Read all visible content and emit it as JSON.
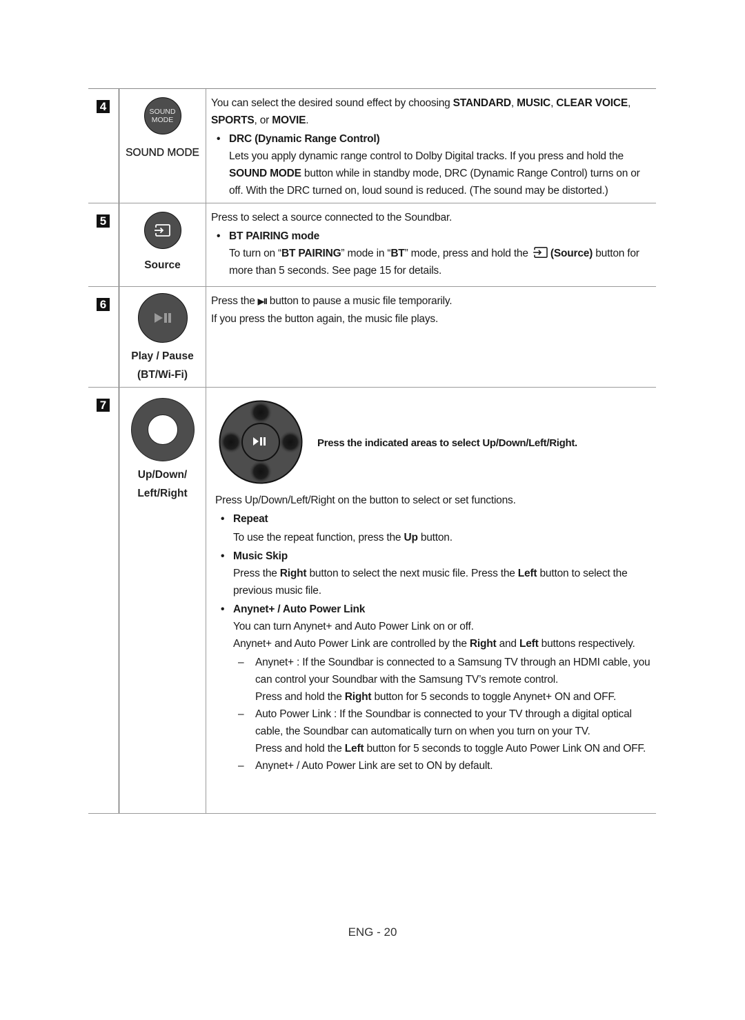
{
  "rows": [
    {
      "number": "4",
      "icon": "sound-mode-button-icon",
      "icon_text": [
        "SOUND",
        "MODE"
      ],
      "label": "SOUND MODE",
      "intro": {
        "t1": "You can select the desired sound effect by choosing ",
        "b1": "STANDARD",
        "t2": ", ",
        "b2": "MUSIC",
        "t3": ", ",
        "b3": "CLEAR VOICE",
        "t4": ", ",
        "b4": "SPORTS",
        "t5": ", or ",
        "b5": "MOVIE",
        "t6": "."
      },
      "bullet": {
        "title": "DRC (Dynamic Range Control)",
        "t1": "Lets you apply dynamic range control to Dolby Digital tracks. If you press and hold the ",
        "b1": "SOUND MODE",
        "t2": " button while in standby mode, DRC (Dynamic Range Control) turns on or off. With the DRC turned on, loud sound is reduced. (The sound may be distorted.)"
      }
    },
    {
      "number": "5",
      "icon": "source-icon",
      "label": "Source",
      "intro": "Press to select a source connected to the Soundbar.",
      "bullet": {
        "title": "BT PAIRING mode",
        "t1": "To turn on “",
        "b1": "BT PAIRING",
        "t2": "” mode in “",
        "b2": "BT",
        "t3": "” mode, press and hold the ",
        "b3": "(Source)",
        "t4": " button for more than 5 seconds. See page 15 for details."
      }
    },
    {
      "number": "6",
      "icon": "play-pause-icon",
      "label_lines": [
        "Play / Pause",
        "(BT/Wi-Fi)"
      ],
      "line1_a": "Press the ",
      "line1_glyph": "▶II",
      "line1_b": " button to pause a music file temporarily.",
      "line2": "If you press the button again, the music file plays."
    },
    {
      "number": "7",
      "icon": "navigation-ring-icon",
      "label_lines": [
        "Up/Down/",
        "Left/Right"
      ],
      "diagram_caption": "Press the indicated areas to select Up/Down/Left/Right.",
      "intro": "Press Up/Down/Left/Right on the button to select or set functions.",
      "repeat": {
        "title": "Repeat",
        "t1": "To use the repeat function, press the ",
        "b1": "Up",
        "t2": " button."
      },
      "music_skip": {
        "title": "Music Skip",
        "t1": "Press the ",
        "b1": "Right",
        "t2": " button to select the next music file. Press the ",
        "b2": "Left",
        "t3": " button to select the previous music file."
      },
      "anynet": {
        "title": "Anynet+ / Auto Power Link",
        "line1": "You can turn Anynet+ and Auto Power Link on or off.",
        "l2_t1": "Anynet+ and Auto Power Link are controlled by the ",
        "l2_b1": "Right",
        "l2_t2": " and ",
        "l2_b2": "Left",
        "l2_t3": " buttons respectively.",
        "dash_mark": "–",
        "d1_t1": "Anynet+ : If the Soundbar is connected to a Samsung TV through an HDMI cable, you can control your Soundbar with the Samsung TV’s remote control.",
        "d1_t2": "Press and hold the ",
        "d1_b1": "Right",
        "d1_t3": " button for 5 seconds to toggle Anynet+ ON and OFF.",
        "d2_t1": "Auto Power Link : If the Soundbar is connected to your TV through a digital optical cable, the Soundbar can automatically turn on when you turn on your TV.",
        "d2_t2": "Press and hold the ",
        "d2_b1": "Left",
        "d2_t3": " button for 5 seconds to toggle Auto Power Link ON and OFF.",
        "d3": "Anynet+ / Auto Power Link are set to ON by default."
      }
    }
  ],
  "footer": {
    "page": "ENG - 20"
  }
}
